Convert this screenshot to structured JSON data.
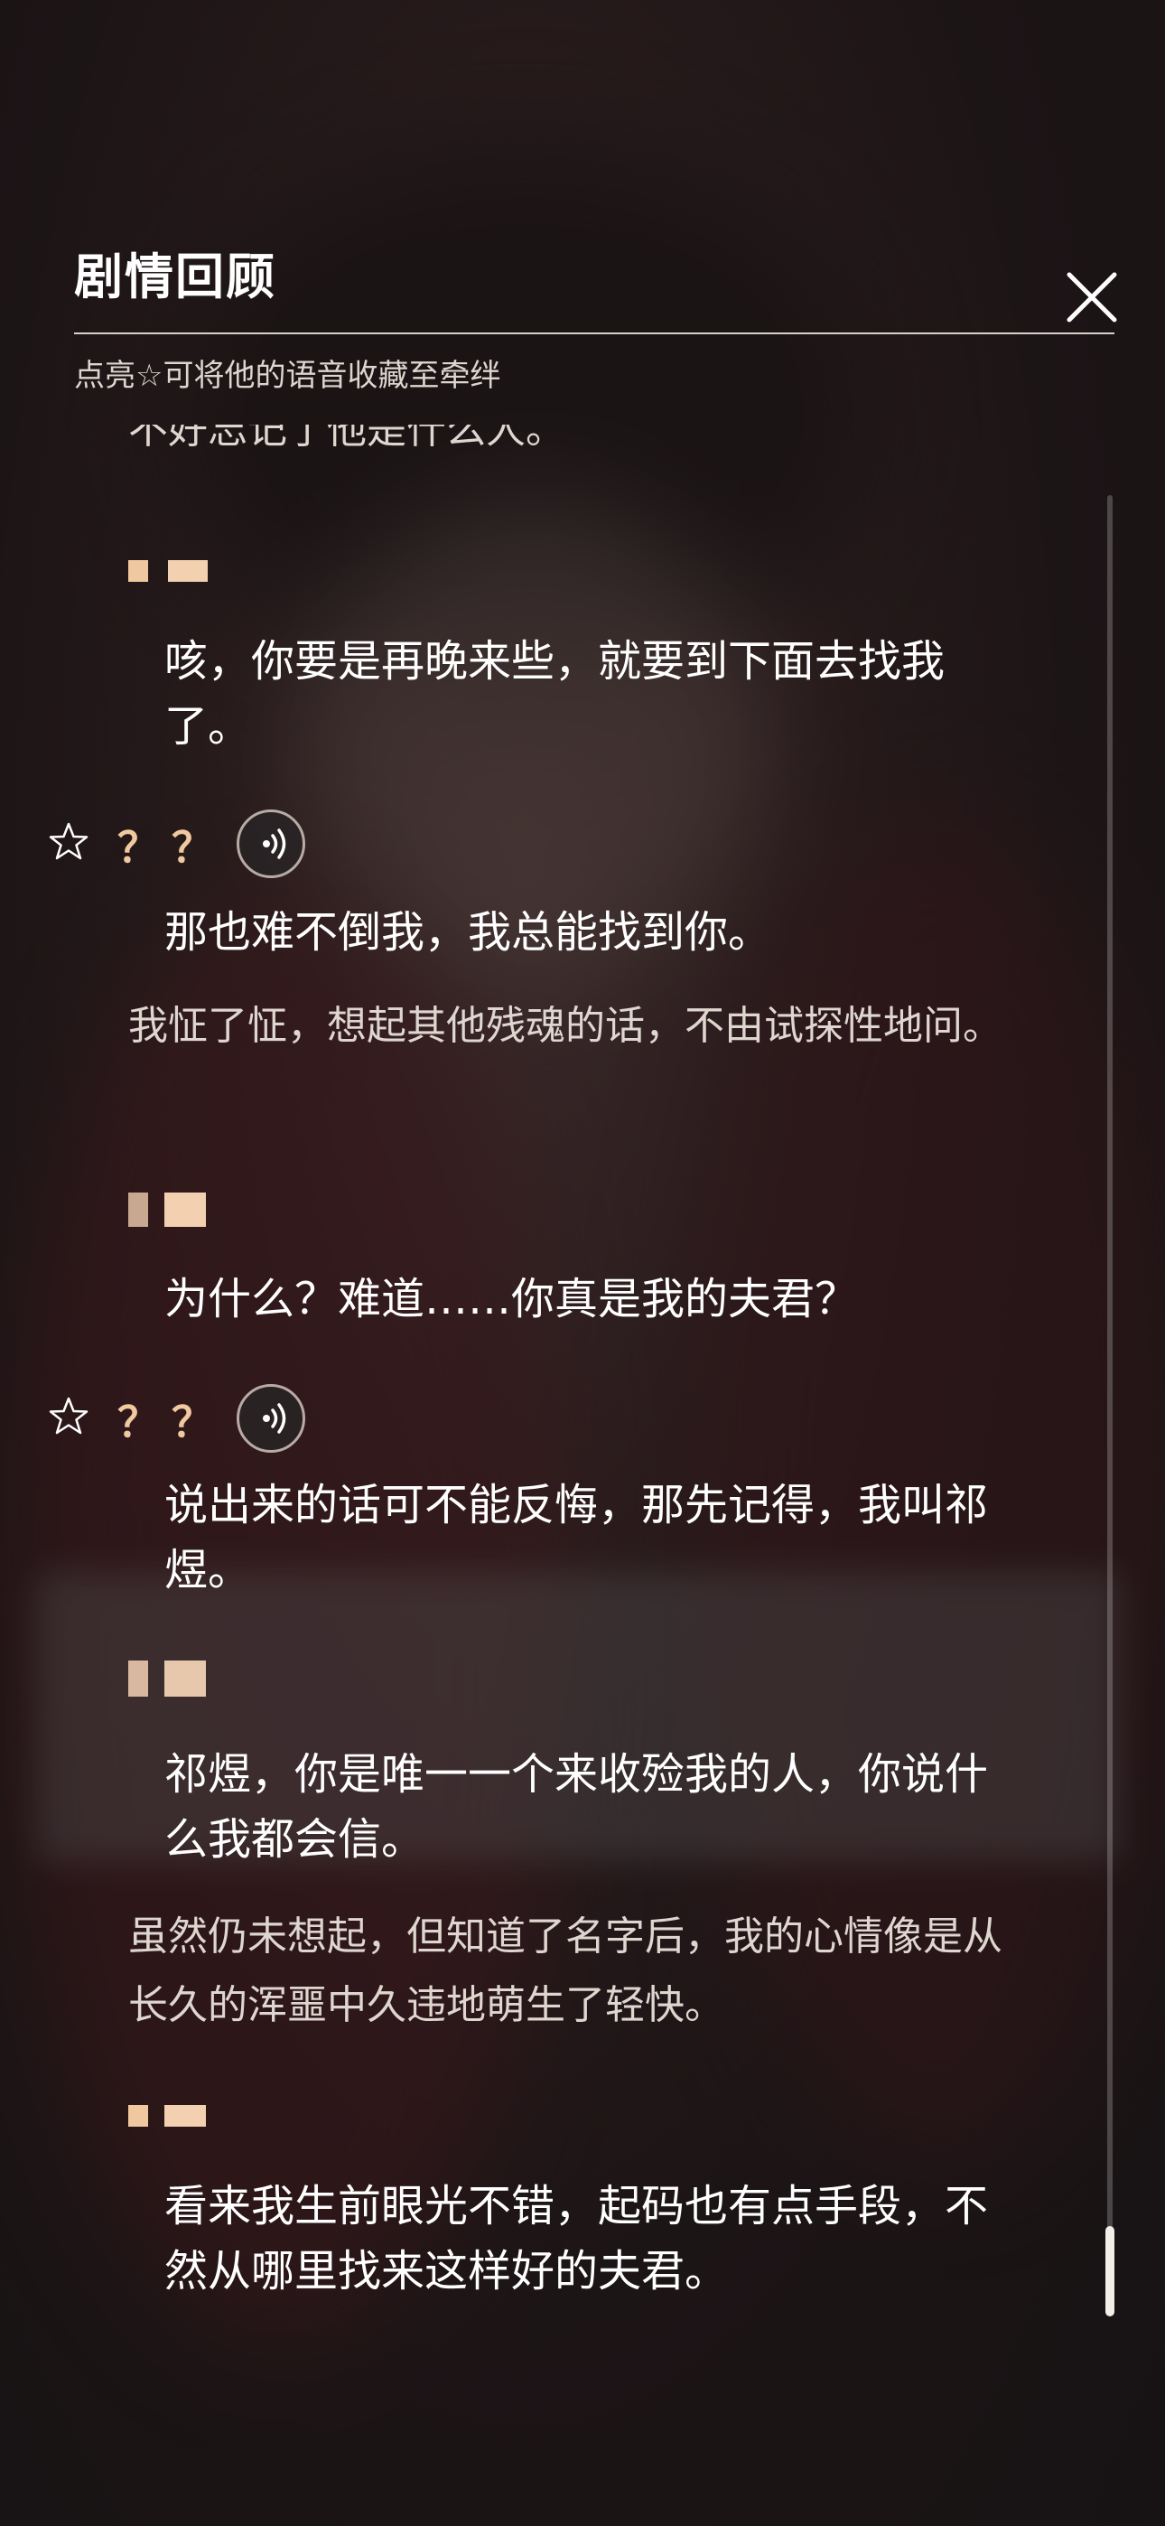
{
  "header": {
    "title": "剧情回顾",
    "hint": "点亮☆可将他的语音收藏至牵绊"
  },
  "dialogue": {
    "cut_line": "不好忘记了他是什么人。",
    "line1": "咳，你要是再晚来些，就要到下面去找我了。",
    "speaker2": "？？",
    "line2": "那也难不倒我，我总能找到你。",
    "narr1": "我怔了怔，想起其他残魂的话，不由试探性地问。",
    "line3": "为什么？难道……你真是我的夫君？",
    "speaker4": "？？",
    "line4": "说出来的话可不能反悔，那先记得，我叫祁煜。",
    "line5": "祁煜，你是唯一一个来收殓我的人，你说什么我都会信。",
    "narr2": "虽然仍未想起，但知道了名字后，我的心情像是从长久的浑噩中久违地萌生了轻快。",
    "line6": "看来我生前眼光不错，起码也有点手段，不然从哪里找来这样好的夫君。"
  },
  "colors": {
    "accent": "#f1c9a0",
    "text": "#ffffff",
    "narration": "#ded6cf"
  },
  "icons": {
    "close": "close-icon",
    "star": "star-outline-icon",
    "voice": "voice-play-icon"
  }
}
